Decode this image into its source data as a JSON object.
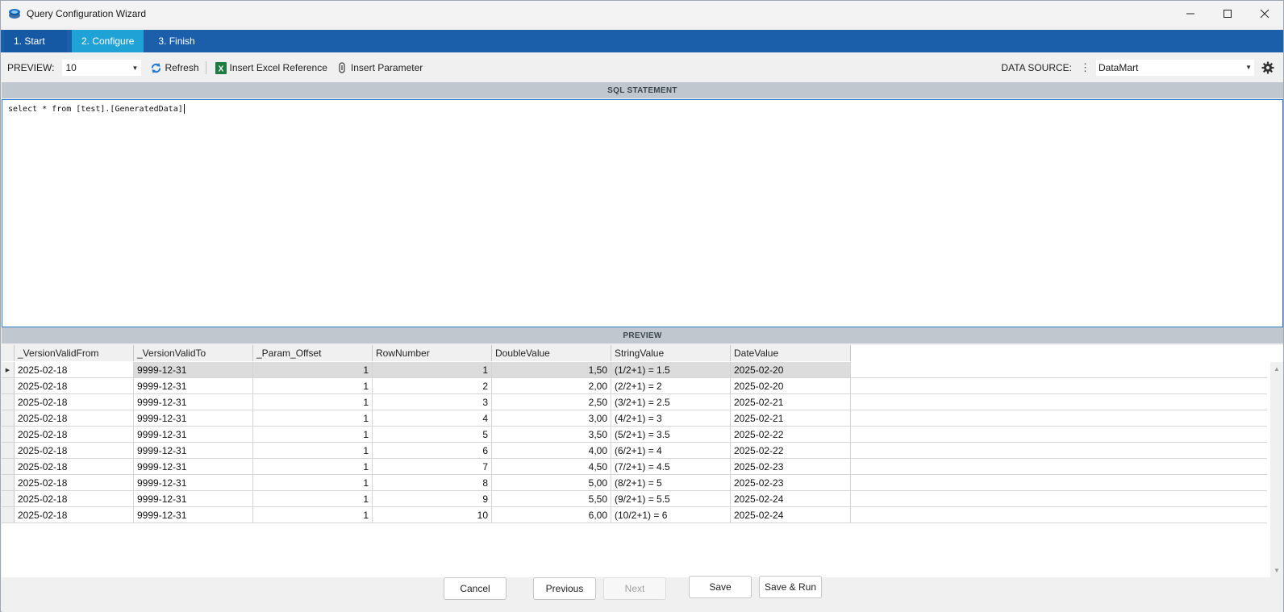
{
  "window": {
    "title": "Query Configuration Wizard",
    "controls": {
      "minimize": "—",
      "maximize": "☐",
      "close": "✕"
    }
  },
  "steps": [
    {
      "label": "1. Start",
      "active": false
    },
    {
      "label": "2. Configure",
      "active": true
    },
    {
      "label": "3. Finish",
      "active": false
    }
  ],
  "toolbar": {
    "preview_label": "PREVIEW:",
    "preview_value": "10",
    "refresh_label": "Refresh",
    "insert_excel_label": "Insert Excel Reference",
    "insert_param_label": "Insert Parameter",
    "datasource_label": "DATA SOURCE:",
    "datasource_value": "DataMart"
  },
  "sql_section": {
    "header": "SQL STATEMENT",
    "text": "select * from [test].[GeneratedData]"
  },
  "preview_section": {
    "header": "PREVIEW",
    "columns": [
      "_VersionValidFrom",
      "_VersionValidTo",
      "_Param_Offset",
      "RowNumber",
      "DoubleValue",
      "StringValue",
      "DateValue"
    ],
    "rows": [
      [
        "2025-02-18",
        "9999-12-31",
        "1",
        "1",
        "1,50",
        "(1/2+1) = 1.5",
        "2025-02-20"
      ],
      [
        "2025-02-18",
        "9999-12-31",
        "1",
        "2",
        "2,00",
        "(2/2+1) = 2",
        "2025-02-20"
      ],
      [
        "2025-02-18",
        "9999-12-31",
        "1",
        "3",
        "2,50",
        "(3/2+1) = 2.5",
        "2025-02-21"
      ],
      [
        "2025-02-18",
        "9999-12-31",
        "1",
        "4",
        "3,00",
        "(4/2+1) = 3",
        "2025-02-21"
      ],
      [
        "2025-02-18",
        "9999-12-31",
        "1",
        "5",
        "3,50",
        "(5/2+1) = 3.5",
        "2025-02-22"
      ],
      [
        "2025-02-18",
        "9999-12-31",
        "1",
        "6",
        "4,00",
        "(6/2+1) = 4",
        "2025-02-22"
      ],
      [
        "2025-02-18",
        "9999-12-31",
        "1",
        "7",
        "4,50",
        "(7/2+1) = 4.5",
        "2025-02-23"
      ],
      [
        "2025-02-18",
        "9999-12-31",
        "1",
        "8",
        "5,00",
        "(8/2+1) = 5",
        "2025-02-23"
      ],
      [
        "2025-02-18",
        "9999-12-31",
        "1",
        "9",
        "5,50",
        "(9/2+1) = 5.5",
        "2025-02-24"
      ],
      [
        "2025-02-18",
        "9999-12-31",
        "1",
        "10",
        "6,00",
        "(10/2+1) = 6",
        "2025-02-24"
      ]
    ],
    "selected_row": 0
  },
  "footer": {
    "cancel": "Cancel",
    "previous": "Previous",
    "next": "Next",
    "save": "Save",
    "save_run": "Save & Run"
  },
  "colors": {
    "steps_bar": "#1b5ea9",
    "step_active": "#1fa3d7",
    "section_header": "#c0c7cf",
    "editor_border": "#2c7bd1"
  }
}
